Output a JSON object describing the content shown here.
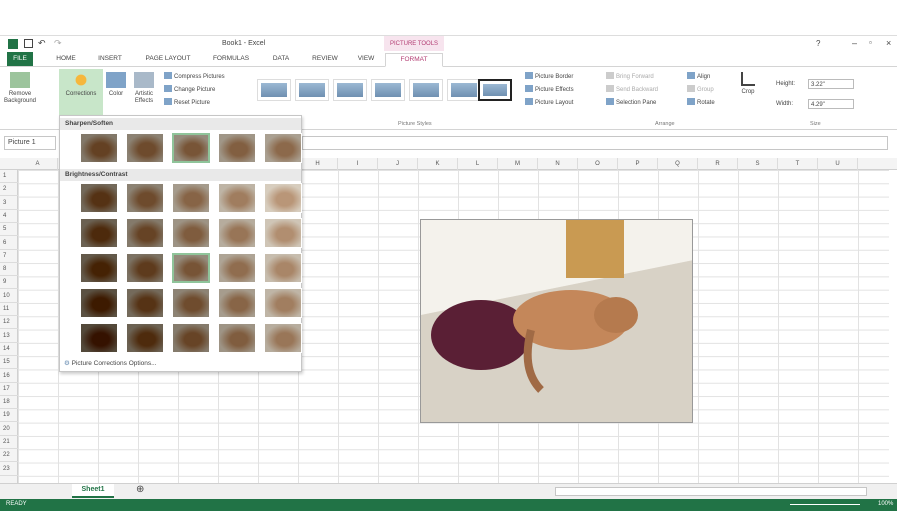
{
  "title": {
    "doc": "Book1 - Excel",
    "tools": "PICTURE TOOLS"
  },
  "tabs": [
    "FILE",
    "HOME",
    "INSERT",
    "PAGE LAYOUT",
    "FORMULAS",
    "DATA",
    "REVIEW",
    "VIEW",
    "FORMAT"
  ],
  "ribbon": {
    "remove_background": "Remove Background",
    "corrections": "Corrections",
    "color": "Color",
    "artistic": "Artistic Effects",
    "compress": "Compress Pictures",
    "change": "Change Picture",
    "reset": "Reset Picture",
    "picture_border": "Picture Border",
    "picture_effects": "Picture Effects",
    "picture_layout": "Picture Layout",
    "picture_styles": "Picture Styles",
    "bring_forward": "Bring Forward",
    "send_backward": "Send Backward",
    "selection_pane": "Selection Pane",
    "align": "Align",
    "group": "Group",
    "rotate": "Rotate",
    "arrange": "Arrange",
    "crop": "Crop",
    "height_label": "Height:",
    "height_value": "3.22\"",
    "width_label": "Width:",
    "width_value": "4.29\"",
    "size": "Size"
  },
  "namebox": "Picture 1",
  "columns": [
    "A",
    "B",
    "C",
    "D",
    "E",
    "F",
    "G",
    "H",
    "I",
    "J",
    "K",
    "L",
    "M",
    "N",
    "O",
    "P",
    "Q",
    "R",
    "S",
    "T",
    "U"
  ],
  "rows": [
    "1",
    "2",
    "3",
    "4",
    "5",
    "6",
    "7",
    "8",
    "9",
    "10",
    "11",
    "12",
    "13",
    "14",
    "15",
    "16",
    "17",
    "18",
    "19",
    "20",
    "21",
    "22",
    "23"
  ],
  "dropdown": {
    "sharpen": "Sharpen/Soften",
    "brightness": "Brightness/Contrast",
    "options": "Picture Corrections Options..."
  },
  "sheet_tab": "Sheet1",
  "status": "READY",
  "zoom": "100%",
  "colors": {
    "accent": "#217346",
    "format_tab": "#b33d73"
  }
}
